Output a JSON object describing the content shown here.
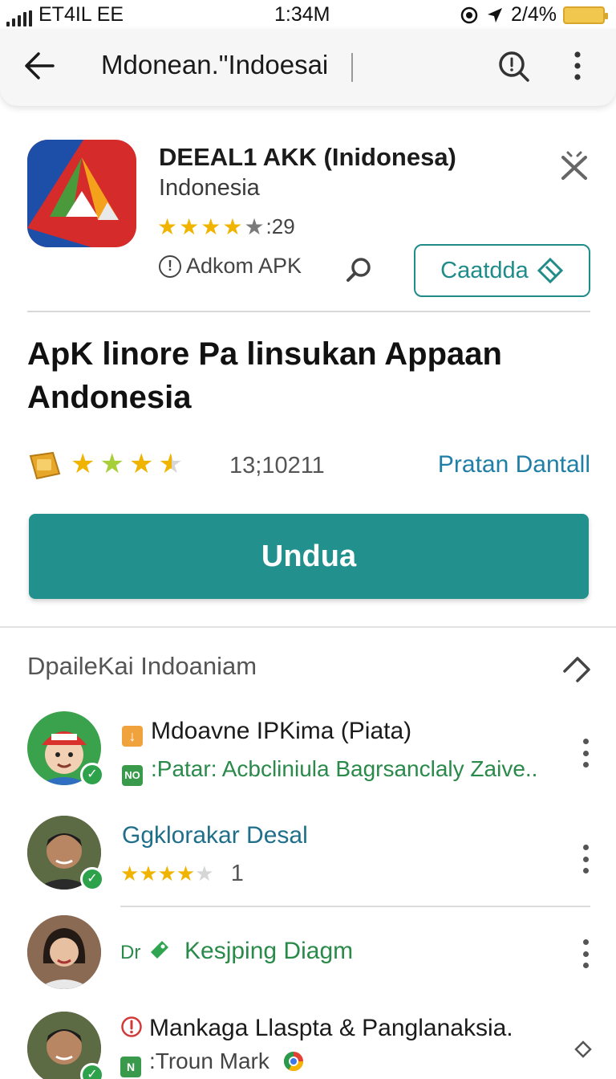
{
  "status_bar": {
    "carrier": "ET4IL EE",
    "time": "1:34M",
    "battery_text": "2/4%"
  },
  "app_bar": {
    "title": "Mdonean.\"Indoesai",
    "back_icon": "arrow-left-icon",
    "search_icon": "search-icon",
    "menu_icon": "more-vertical-icon"
  },
  "app_header": {
    "name": "DEEAL1 AKK (Inidonesa)",
    "region": "Indonesia",
    "rating_text": ":29",
    "publisher": "Adkom APK",
    "action_button": "Caatdda"
  },
  "headline": "ApK linore Pa linsukan Appaan Andonesia",
  "rating": {
    "count": "13;10211",
    "link": "Pratan Dantall"
  },
  "primary_button": "Undua",
  "section": {
    "title": "DpaileKai Indoaniam"
  },
  "list": [
    {
      "title": "Mdoavne IPKima (Piata)",
      "sub_tag": "NO",
      "sub_text": ":Patar: Acbcliniula Bagrsanclaly Zaive.."
    },
    {
      "title": "Ggklorakar Desal",
      "rating_count": "1"
    },
    {
      "prefix": "Dr",
      "title": "Kesjping Diagm"
    },
    {
      "title": "Mankaga Llaspta & Panglanaksia.",
      "sub_tag": "N",
      "sub_text": ":Troun Mark"
    }
  ],
  "colors": {
    "accent": "#22918d",
    "link": "#1f7fa6",
    "star": "#f0b400",
    "green_text": "#2a8a4a",
    "teal_title": "#1f6f8b"
  }
}
